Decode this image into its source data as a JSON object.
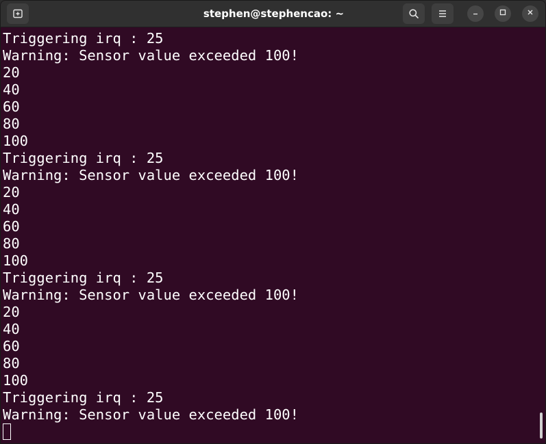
{
  "window": {
    "title": "stephen@stephencao: ~"
  },
  "titlebar": {
    "new_tab_icon": "new-tab-icon",
    "search_icon": "search-icon",
    "menu_icon": "hamburger-menu-icon",
    "minimize_icon": "minimize-icon",
    "maximize_icon": "maximize-icon",
    "close_icon": "close-icon"
  },
  "colors": {
    "terminal_bg": "#300a24",
    "text": "#ffffff",
    "titlebar_bg": "#303030"
  },
  "terminal": {
    "lines": [
      "Triggering irq : 25",
      "Warning: Sensor value exceeded 100!",
      "20",
      "40",
      "60",
      "80",
      "100",
      "Triggering irq : 25",
      "Warning: Sensor value exceeded 100!",
      "20",
      "40",
      "60",
      "80",
      "100",
      "Triggering irq : 25",
      "Warning: Sensor value exceeded 100!",
      "20",
      "40",
      "60",
      "80",
      "100",
      "Triggering irq : 25",
      "Warning: Sensor value exceeded 100!"
    ]
  }
}
